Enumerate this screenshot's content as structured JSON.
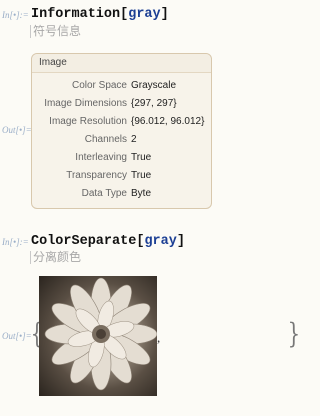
{
  "cells": [
    {
      "in_label": "In[•]:=",
      "func": "Information",
      "arg": "gray",
      "hint": "符号信息"
    },
    {
      "in_label": "In[•]:=",
      "func": "ColorSeparate",
      "arg": "gray",
      "hint": "分离颜色"
    }
  ],
  "info_panel": {
    "out_label": "Out[•]=",
    "title": "Image",
    "rows": [
      {
        "key": "Color Space",
        "value": "Grayscale"
      },
      {
        "key": "Image Dimensions",
        "value": "{297, 297}"
      },
      {
        "key": "Image Resolution",
        "value": "{96.012, 96.012}"
      },
      {
        "key": "Channels",
        "value": "2"
      },
      {
        "key": "Interleaving",
        "value": "True"
      },
      {
        "key": "Transparency",
        "value": "True"
      },
      {
        "key": "Data Type",
        "value": "Byte"
      }
    ]
  },
  "output": {
    "out_label": "Out[•]=",
    "open_brace": "{",
    "separator": ",",
    "close_brace": "}"
  }
}
